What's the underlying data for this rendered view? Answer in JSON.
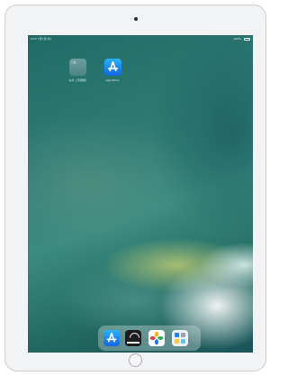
{
  "device": {
    "name": "iPad"
  },
  "status_bar": {
    "time": "9:57",
    "date": "7月7日(木)",
    "battery": "100%"
  },
  "home_screen": {
    "apps": [
      {
        "id": "folder",
        "label": "なれ ご利用例",
        "badge": "二台"
      },
      {
        "id": "app_store",
        "label": "App Store"
      }
    ]
  },
  "dock": {
    "items": [
      {
        "id": "app_store",
        "icon": "app-store-icon"
      },
      {
        "id": "photo_app",
        "icon": "photo-app-icon"
      },
      {
        "id": "photos",
        "icon": "photos-icon"
      },
      {
        "id": "camera_app",
        "icon": "camera-app-icon"
      }
    ]
  },
  "colors": {
    "wallpaper_dark": "#1f6b67",
    "wallpaper_mid": "#3b8b80",
    "wallpaper_light": "#d0d678",
    "accent_blue": "#1466e0"
  }
}
